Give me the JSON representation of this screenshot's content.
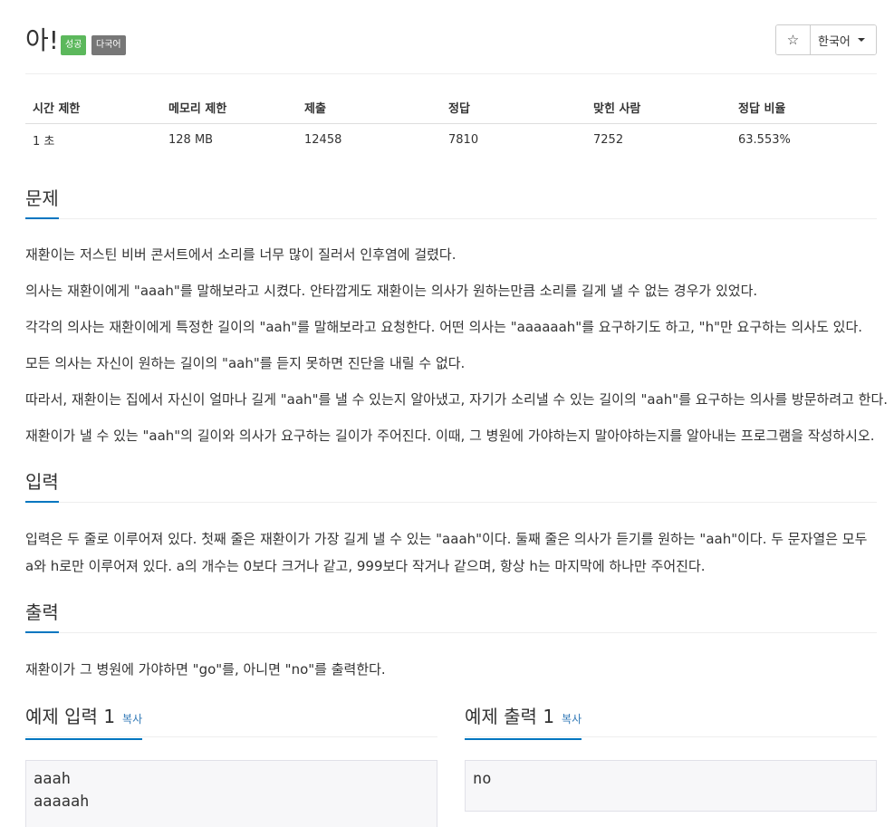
{
  "problem": {
    "title": "아!",
    "badge_success": "성공",
    "badge_lang": "다국어",
    "star_icon": "☆",
    "language": "한국어"
  },
  "stats": {
    "headers": [
      "시간 제한",
      "메모리 제한",
      "제출",
      "정답",
      "맞힌 사람",
      "정답 비율"
    ],
    "values": [
      "1 초",
      "128 MB",
      "12458",
      "7810",
      "7252",
      "63.553%"
    ]
  },
  "sections": {
    "problem_title": "문제",
    "problem_paragraphs": [
      "재환이는 저스틴 비버 콘서트에서 소리를 너무 많이 질러서 인후염에 걸렸다.",
      "의사는 재환이에게 \"aaah\"를 말해보라고 시켰다. 안타깝게도 재환이는 의사가 원하는만큼 소리를 길게 낼 수 없는 경우가 있었다.",
      "각각의 의사는 재환이에게 특정한 길이의 \"aah\"를 말해보라고 요청한다. 어떤 의사는 \"aaaaaah\"를 요구하기도 하고, \"h\"만 요구하는 의사도 있다.",
      "모든 의사는 자신이 원하는 길이의 \"aah\"를 듣지 못하면 진단을 내릴 수 없다.",
      "따라서, 재환이는 집에서 자신이 얼마나 길게 \"aah\"를 낼 수 있는지 알아냈고, 자기가 소리낼 수 있는 길이의 \"aah\"를 요구하는 의사를 방문하려고 한다.",
      "재환이가 낼 수 있는 \"aah\"의 길이와 의사가 요구하는 길이가 주어진다. 이때, 그 병원에 가야하는지 말아야하는지를 알아내는 프로그램을 작성하시오."
    ],
    "input_title": "입력",
    "input_text": "입력은 두 줄로 이루어져 있다. 첫째 줄은 재환이가 가장 길게 낼 수 있는 \"aaah\"이다. 둘째 줄은 의사가 듣기를 원하는 \"aah\"이다. 두 문자열은 모두 a와 h로만 이루어져 있다. a의 개수는 0보다 크거나 같고, 999보다 작거나 같으며, 항상 h는 마지막에 하나만 주어진다.",
    "output_title": "출력",
    "output_text": "재환이가 그 병원에 가야하면 \"go\"를, 아니면 \"no\"를 출력한다."
  },
  "samples": {
    "input_title": "예제 입력 1",
    "output_title": "예제 출력 1",
    "copy_label": "복사",
    "input_lines": [
      "aaah",
      "aaaaah"
    ],
    "output_lines": [
      "no"
    ]
  }
}
